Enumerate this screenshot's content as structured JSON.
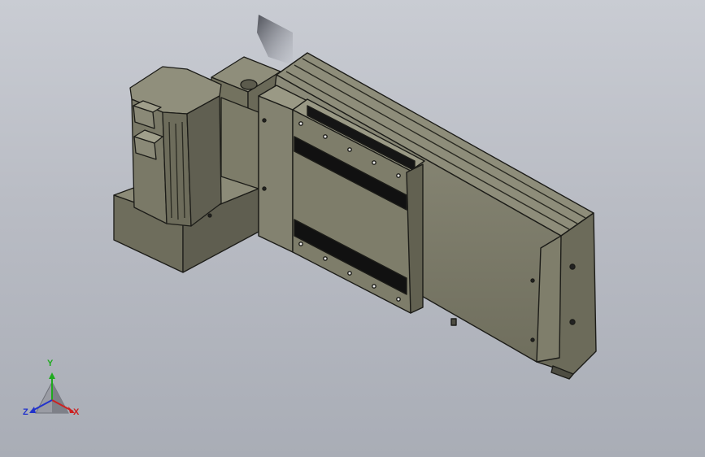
{
  "view": {
    "background_top": "#c9ccd3",
    "background_bottom": "#a9adb6"
  },
  "model": {
    "name": "linear-actuator-with-motor",
    "body_color": "#7b7a68",
    "edge_color": "#1c1c18",
    "rail_color": "#111111"
  },
  "triad": {
    "y_label": "Y",
    "z_label": "Z",
    "x_label": "X",
    "y_color": "#1faa1f",
    "z_color": "#2233cc",
    "x_color": "#cc2222"
  }
}
